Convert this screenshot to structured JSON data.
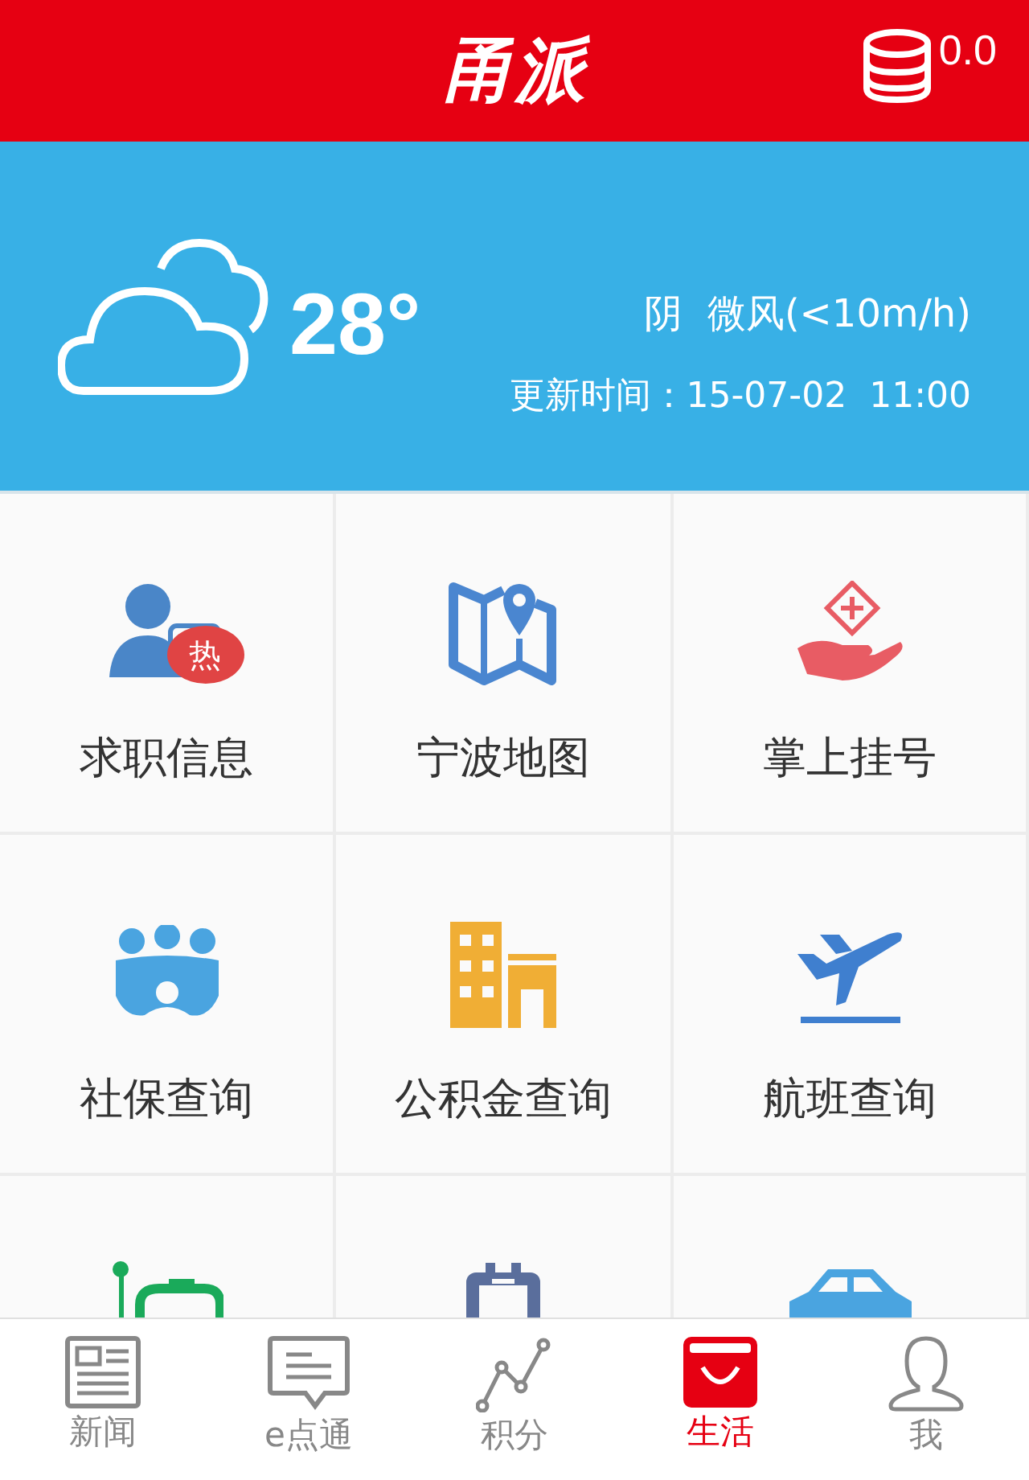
{
  "header": {
    "logo": "甬派",
    "coins": "0.0"
  },
  "weather": {
    "temperature": "28°",
    "condition": "阴  微风(<10m/h)",
    "updated": "更新时间：15-07-02  11:00"
  },
  "services": [
    {
      "kind": "tile",
      "label": "求职信息",
      "badge": "热"
    },
    {
      "kind": "tile",
      "label": "宁波地图"
    },
    {
      "kind": "tile",
      "label": "掌上挂号"
    },
    {
      "kind": "tile",
      "label": "社保查询"
    },
    {
      "kind": "tile",
      "label": "公积金查询"
    },
    {
      "kind": "tile",
      "label": "航班查询"
    },
    {
      "kind": "cut"
    },
    {
      "kind": "cut"
    },
    {
      "kind": "cut"
    }
  ],
  "tabs": [
    {
      "label": "新闻",
      "selected": false
    },
    {
      "label": "e点通",
      "selected": false
    },
    {
      "label": "积分",
      "selected": false
    },
    {
      "label": "生活",
      "selected": true
    },
    {
      "label": "我",
      "selected": false
    }
  ]
}
